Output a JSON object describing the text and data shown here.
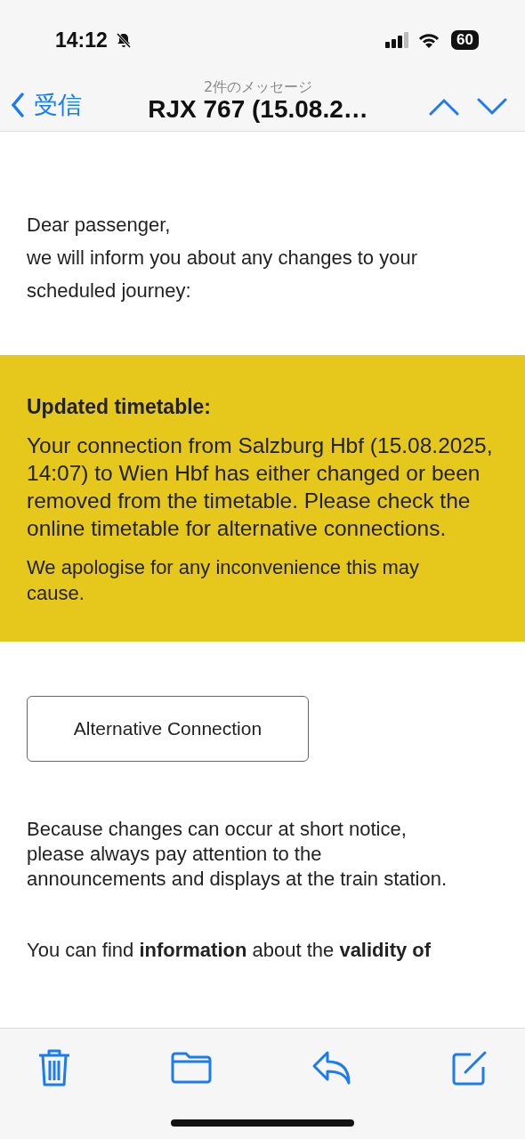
{
  "status_bar": {
    "time": "14:12",
    "battery": "60"
  },
  "nav": {
    "back": "受信",
    "subtitle": "2件のメッセージ",
    "title": "RJX 767 (15.08.2…"
  },
  "greeting": [
    "Dear passenger,",
    "we will inform you about any changes to your scheduled journey:"
  ],
  "notice": {
    "heading": "Updated timetable:",
    "body": "Your connection from Salzburg Hbf (15.08.2025, 14:07) to Wien Hbf has either changed or been removed from the timetable. Please check the online timetable for alternative connections.",
    "apology": "We apologise for any inconvenience this may cause."
  },
  "button": "Alternative Connection",
  "paragraphs": [
    "Because changes can occur at short notice, please always pay attention to the announcements and displays at the train station.",
    "You can find **information** about the **validity of**"
  ]
}
